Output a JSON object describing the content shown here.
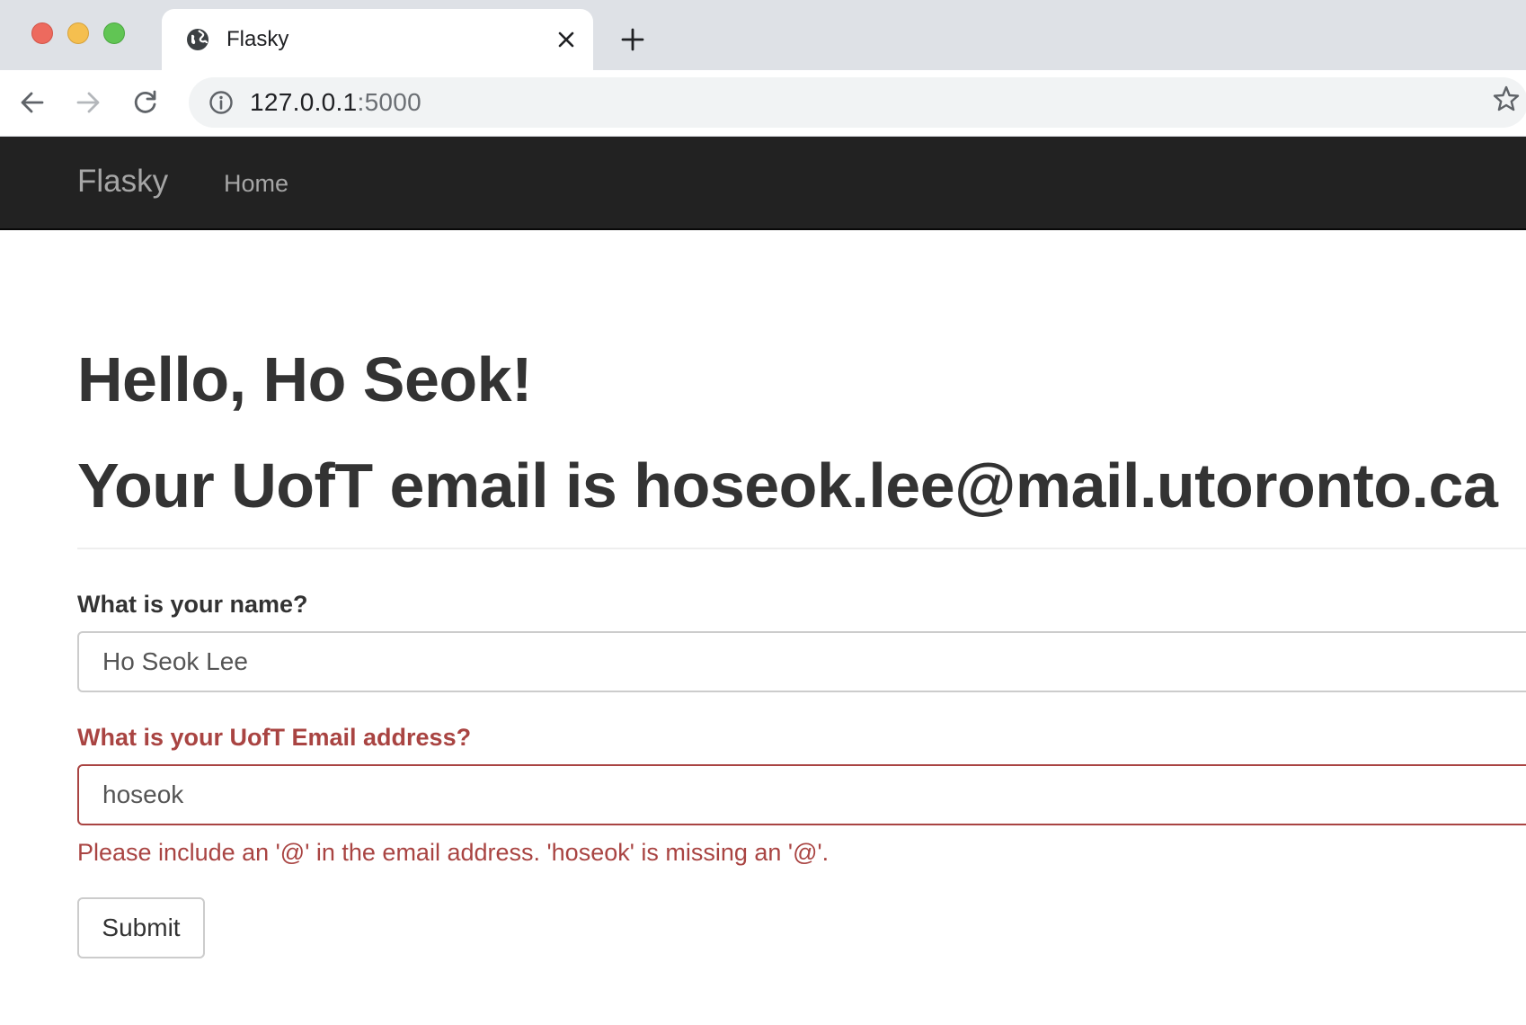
{
  "browser": {
    "tab": {
      "title": "Flasky",
      "favicon": "globe-icon",
      "close_icon": "close-icon"
    },
    "new_tab_icon": "plus-icon",
    "toolbar": {
      "back_icon": "back-arrow-icon",
      "forward_icon": "forward-arrow-icon",
      "reload_icon": "reload-icon",
      "url_host": "127.0.0.1",
      "url_port": ":5000",
      "site_info_icon": "info-icon",
      "bookmark_icon": "star-icon"
    }
  },
  "navbar": {
    "brand": "Flasky",
    "links": [
      {
        "label": "Home"
      }
    ]
  },
  "main": {
    "greeting": "Hello, Ho Seok!",
    "email_heading": "Your UofT email is hoseok.lee@mail.utoronto.ca",
    "form": {
      "name_label": "What is your name?",
      "name_value": "Ho Seok Lee",
      "email_label": "What is your UofT Email address?",
      "email_value": "hoseok",
      "email_error": "Please include an '@' in the email address. 'hoseok' is missing an '@'.",
      "submit_label": "Submit"
    }
  },
  "colors": {
    "navbar_bg": "#222222",
    "nav_text": "#a6a6a6",
    "error": "#a94442",
    "heading": "#333333",
    "tabstrip_bg": "#dee1e6"
  }
}
